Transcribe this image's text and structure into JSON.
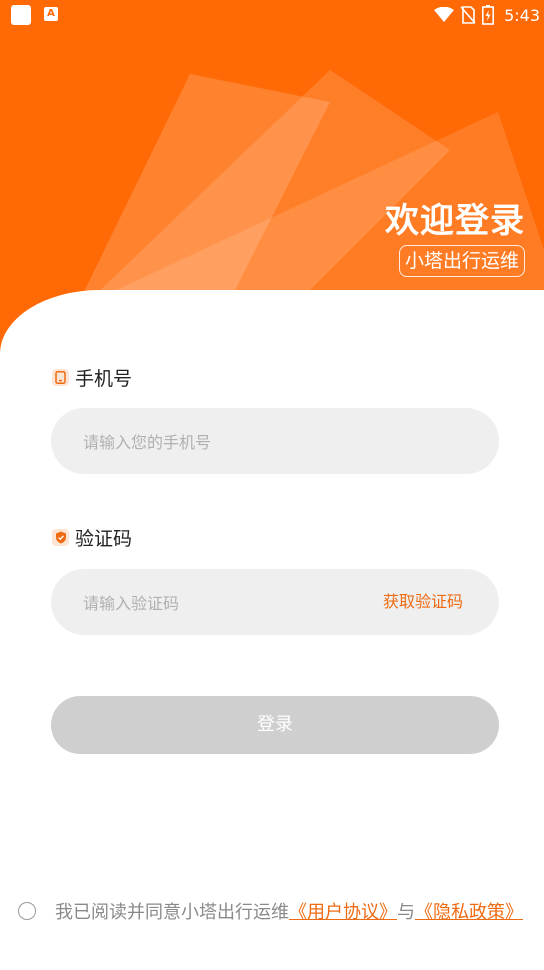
{
  "status_bar": {
    "time": "5:43",
    "app_glyph": "A",
    "icons": [
      "notification-square-icon",
      "app-notification-icon",
      "wifi-icon",
      "no-sim-icon",
      "battery-charging-icon"
    ]
  },
  "header": {
    "welcome": "欢迎登录",
    "subtitle": "小塔出行运维"
  },
  "form": {
    "phone": {
      "label": "手机号",
      "placeholder": "请输入您的手机号",
      "value": "",
      "icon": "phone-icon"
    },
    "code": {
      "label": "验证码",
      "placeholder": "请输入验证码",
      "value": "",
      "get_code_label": "获取验证码",
      "icon": "shield-icon"
    },
    "login_label": "登录"
  },
  "agreement": {
    "prefix": "我已阅读并同意小塔出行运维",
    "user_agreement": "《用户协议》",
    "middle": "与",
    "privacy_policy": "《隐私政策》",
    "checked": false
  },
  "colors": {
    "accent": "#ff6a06",
    "link": "#ef6b12",
    "input_bg": "#efefef",
    "button_disabled": "#cfcfcf"
  }
}
